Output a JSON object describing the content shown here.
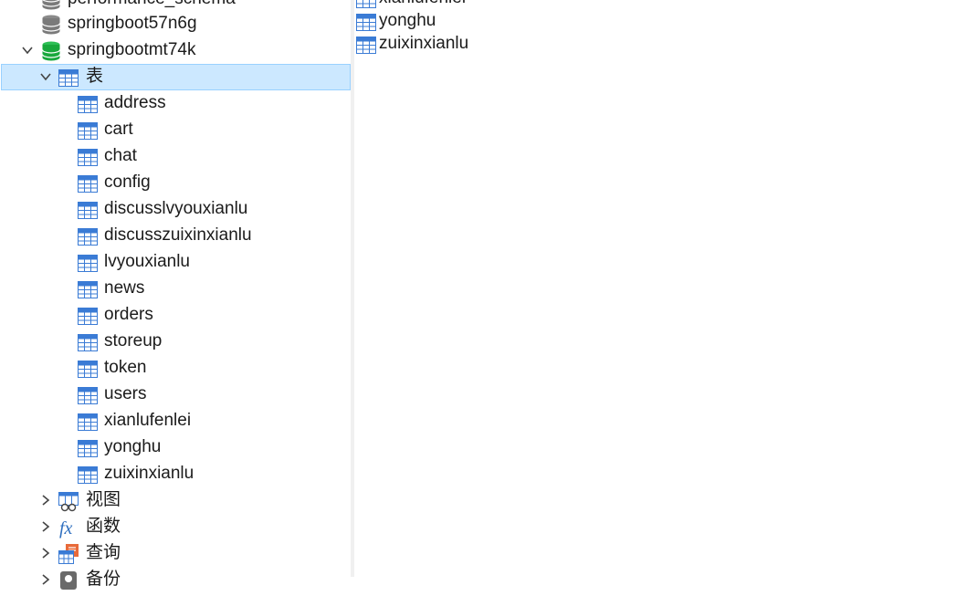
{
  "tree": {
    "databases": [
      {
        "label": "performance_schema"
      },
      {
        "label": "springboot57n6g"
      },
      {
        "label": "springbootmt74k"
      }
    ],
    "tables_node": {
      "label": "表"
    },
    "tables": [
      {
        "label": "address"
      },
      {
        "label": "cart"
      },
      {
        "label": "chat"
      },
      {
        "label": "config"
      },
      {
        "label": "discusslvyouxianlu"
      },
      {
        "label": "discusszuixinxianlu"
      },
      {
        "label": "lvyouxianlu"
      },
      {
        "label": "news"
      },
      {
        "label": "orders"
      },
      {
        "label": "storeup"
      },
      {
        "label": "token"
      },
      {
        "label": "users"
      },
      {
        "label": "xianlufenlei"
      },
      {
        "label": "yonghu"
      },
      {
        "label": "zuixinxianlu"
      }
    ],
    "other_nodes": [
      {
        "label": "视图",
        "icon": "view-icon"
      },
      {
        "label": "函数",
        "icon": "function-icon"
      },
      {
        "label": "查询",
        "icon": "query-icon"
      },
      {
        "label": "备份",
        "icon": "backup-icon"
      }
    ]
  },
  "object_list": {
    "items": [
      {
        "label": "xianlufenlei"
      },
      {
        "label": "yonghu"
      },
      {
        "label": "zuixinxianlu"
      }
    ]
  },
  "colors": {
    "selection_bg": "#cce8ff",
    "selection_border": "#99d1ff",
    "active_db": "#18a83c",
    "inactive_db": "#7a7a7a",
    "table_header": "#3a7bd5"
  }
}
